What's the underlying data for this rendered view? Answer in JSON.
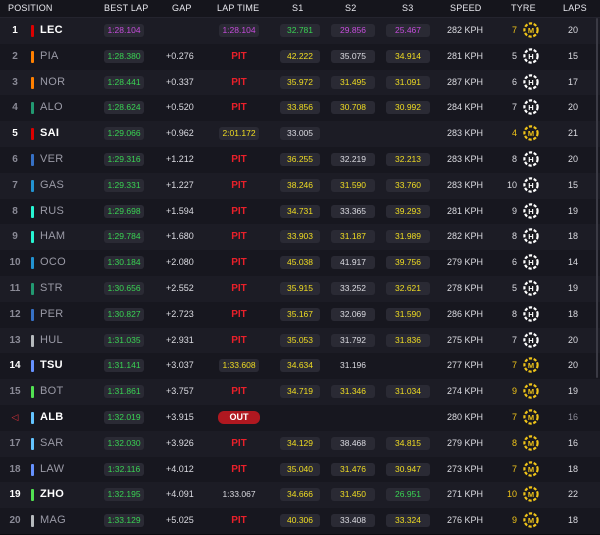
{
  "header": {
    "position": "POSITION",
    "best_lap": "BEST LAP",
    "gap": "GAP",
    "lap_time": "LAP TIME",
    "s1": "S1",
    "s2": "S2",
    "s3": "S3",
    "speed": "SPEED",
    "tyre": "TYRE",
    "laps": "LAPS"
  },
  "colors": {
    "green": "#39d353",
    "purple": "#c64cdc",
    "yellow": "#f0dd22",
    "pit_red": "#e8202a",
    "out_bg": "#b01820",
    "medium_tyre": "#f0c419",
    "hard_tyre": "#ffffff"
  },
  "rows": [
    {
      "pos": "1",
      "code": "LEC",
      "team_color": "#dc0000",
      "hi": true,
      "best": "1:28.104",
      "best_c": "purple",
      "gap": "",
      "lt": "1:28.104",
      "lt_c": "purple",
      "s1": "32.781",
      "s1_c": "green",
      "s2": "29.856",
      "s2_c": "purple",
      "s3": "25.467",
      "s3_c": "purple",
      "speed": "282 KPH",
      "tyre_laps": "7",
      "compound": "M",
      "laps": "20"
    },
    {
      "pos": "2",
      "code": "PIA",
      "team_color": "#ff8000",
      "hi": false,
      "best": "1:28.380",
      "best_c": "green",
      "gap": "+0.276",
      "lt": "PIT",
      "lt_c": "pit",
      "s1": "42.222",
      "s1_c": "yellow",
      "s2": "35.075",
      "s2_c": "white",
      "s3": "34.914",
      "s3_c": "yellow",
      "speed": "281 KPH",
      "tyre_laps": "5",
      "compound": "H",
      "laps": "15"
    },
    {
      "pos": "3",
      "code": "NOR",
      "team_color": "#ff8000",
      "hi": false,
      "best": "1:28.441",
      "best_c": "green",
      "gap": "+0.337",
      "lt": "PIT",
      "lt_c": "pit",
      "s1": "35.972",
      "s1_c": "yellow",
      "s2": "31.495",
      "s2_c": "yellow",
      "s3": "31.091",
      "s3_c": "yellow",
      "speed": "287 KPH",
      "tyre_laps": "6",
      "compound": "H",
      "laps": "17"
    },
    {
      "pos": "4",
      "code": "ALO",
      "team_color": "#229971",
      "hi": false,
      "best": "1:28.624",
      "best_c": "green",
      "gap": "+0.520",
      "lt": "PIT",
      "lt_c": "pit",
      "s1": "33.856",
      "s1_c": "yellow",
      "s2": "30.708",
      "s2_c": "yellow",
      "s3": "30.992",
      "s3_c": "yellow",
      "speed": "284 KPH",
      "tyre_laps": "7",
      "compound": "H",
      "laps": "20"
    },
    {
      "pos": "5",
      "code": "SAI",
      "team_color": "#dc0000",
      "hi": true,
      "best": "1:29.066",
      "best_c": "green",
      "gap": "+0.962",
      "lt": "2:01.172",
      "lt_c": "yellow",
      "s1": "33.005",
      "s1_c": "white",
      "s2": "",
      "s2_c": "none",
      "s3": "",
      "s3_c": "none",
      "speed": "283 KPH",
      "tyre_laps": "4",
      "compound": "M",
      "laps": "21"
    },
    {
      "pos": "6",
      "code": "VER",
      "team_color": "#3671c6",
      "hi": false,
      "best": "1:29.316",
      "best_c": "green",
      "gap": "+1.212",
      "lt": "PIT",
      "lt_c": "pit",
      "s1": "36.255",
      "s1_c": "yellow",
      "s2": "32.219",
      "s2_c": "white",
      "s3": "32.213",
      "s3_c": "yellow",
      "speed": "283 KPH",
      "tyre_laps": "8",
      "compound": "H",
      "laps": "20"
    },
    {
      "pos": "7",
      "code": "GAS",
      "team_color": "#2293d1",
      "hi": false,
      "best": "1:29.331",
      "best_c": "green",
      "gap": "+1.227",
      "lt": "PIT",
      "lt_c": "pit",
      "s1": "38.246",
      "s1_c": "yellow",
      "s2": "31.590",
      "s2_c": "yellow",
      "s3": "33.760",
      "s3_c": "yellow",
      "speed": "283 KPH",
      "tyre_laps": "10",
      "compound": "H",
      "laps": "15"
    },
    {
      "pos": "8",
      "code": "RUS",
      "team_color": "#27f4d2",
      "hi": false,
      "best": "1:29.698",
      "best_c": "green",
      "gap": "+1.594",
      "lt": "PIT",
      "lt_c": "pit",
      "s1": "34.731",
      "s1_c": "yellow",
      "s2": "33.365",
      "s2_c": "white",
      "s3": "39.293",
      "s3_c": "yellow",
      "speed": "281 KPH",
      "tyre_laps": "9",
      "compound": "H",
      "laps": "19"
    },
    {
      "pos": "9",
      "code": "HAM",
      "team_color": "#27f4d2",
      "hi": false,
      "best": "1:29.784",
      "best_c": "green",
      "gap": "+1.680",
      "lt": "PIT",
      "lt_c": "pit",
      "s1": "33.903",
      "s1_c": "yellow",
      "s2": "31.187",
      "s2_c": "yellow",
      "s3": "31.989",
      "s3_c": "yellow",
      "speed": "282 KPH",
      "tyre_laps": "8",
      "compound": "H",
      "laps": "18"
    },
    {
      "pos": "10",
      "code": "OCO",
      "team_color": "#2293d1",
      "hi": false,
      "best": "1:30.184",
      "best_c": "green",
      "gap": "+2.080",
      "lt": "PIT",
      "lt_c": "pit",
      "s1": "45.038",
      "s1_c": "yellow",
      "s2": "41.917",
      "s2_c": "white",
      "s3": "39.756",
      "s3_c": "yellow",
      "speed": "279 KPH",
      "tyre_laps": "6",
      "compound": "H",
      "laps": "14"
    },
    {
      "pos": "11",
      "code": "STR",
      "team_color": "#229971",
      "hi": false,
      "best": "1:30.656",
      "best_c": "green",
      "gap": "+2.552",
      "lt": "PIT",
      "lt_c": "pit",
      "s1": "35.915",
      "s1_c": "yellow",
      "s2": "33.252",
      "s2_c": "white",
      "s3": "32.621",
      "s3_c": "yellow",
      "speed": "278 KPH",
      "tyre_laps": "5",
      "compound": "H",
      "laps": "19"
    },
    {
      "pos": "12",
      "code": "PER",
      "team_color": "#3671c6",
      "hi": false,
      "best": "1:30.827",
      "best_c": "green",
      "gap": "+2.723",
      "lt": "PIT",
      "lt_c": "pit",
      "s1": "35.167",
      "s1_c": "yellow",
      "s2": "32.069",
      "s2_c": "white",
      "s3": "31.590",
      "s3_c": "yellow",
      "speed": "286 KPH",
      "tyre_laps": "8",
      "compound": "H",
      "laps": "18"
    },
    {
      "pos": "13",
      "code": "HUL",
      "team_color": "#b6babd",
      "hi": false,
      "best": "1:31.035",
      "best_c": "green",
      "gap": "+2.931",
      "lt": "PIT",
      "lt_c": "pit",
      "s1": "35.053",
      "s1_c": "yellow",
      "s2": "31.792",
      "s2_c": "white",
      "s3": "31.836",
      "s3_c": "yellow",
      "speed": "275 KPH",
      "tyre_laps": "7",
      "compound": "H",
      "laps": "20"
    },
    {
      "pos": "14",
      "code": "TSU",
      "team_color": "#6692ff",
      "hi": true,
      "best": "1:31.141",
      "best_c": "green",
      "gap": "+3.037",
      "lt": "1:33.608",
      "lt_c": "yellow",
      "s1": "34.634",
      "s1_c": "yellow",
      "s2": "31.196",
      "s2_c": "plain",
      "s3": "",
      "s3_c": "none",
      "speed": "277 KPH",
      "tyre_laps": "7",
      "compound": "M",
      "laps": "20"
    },
    {
      "pos": "15",
      "code": "BOT",
      "team_color": "#52e252",
      "hi": false,
      "best": "1:31.861",
      "best_c": "green",
      "gap": "+3.757",
      "lt": "PIT",
      "lt_c": "pit",
      "s1": "34.719",
      "s1_c": "yellow",
      "s2": "31.346",
      "s2_c": "yellow",
      "s3": "31.034",
      "s3_c": "yellow",
      "speed": "274 KPH",
      "tyre_laps": "9",
      "compound": "M",
      "laps": "19"
    },
    {
      "pos": "◁",
      "code": "ALB",
      "team_color": "#64c4ff",
      "hi": true,
      "flag": true,
      "best": "1:32.019",
      "best_c": "green",
      "gap": "+3.915",
      "lt": "OUT",
      "lt_c": "out",
      "s1": "",
      "s1_c": "none",
      "s2": "",
      "s2_c": "none",
      "s3": "",
      "s3_c": "none",
      "speed": "280 KPH",
      "tyre_laps": "7",
      "compound": "M",
      "laps": "16",
      "laps_dim": true
    },
    {
      "pos": "17",
      "code": "SAR",
      "team_color": "#64c4ff",
      "hi": false,
      "best": "1:32.030",
      "best_c": "green",
      "gap": "+3.926",
      "lt": "PIT",
      "lt_c": "pit",
      "s1": "34.129",
      "s1_c": "yellow",
      "s2": "38.468",
      "s2_c": "white",
      "s3": "34.815",
      "s3_c": "yellow",
      "speed": "279 KPH",
      "tyre_laps": "8",
      "compound": "M",
      "laps": "16"
    },
    {
      "pos": "18",
      "code": "LAW",
      "team_color": "#6692ff",
      "hi": false,
      "best": "1:32.116",
      "best_c": "green",
      "gap": "+4.012",
      "lt": "PIT",
      "lt_c": "pit",
      "s1": "35.040",
      "s1_c": "yellow",
      "s2": "31.476",
      "s2_c": "yellow",
      "s3": "30.947",
      "s3_c": "yellow",
      "speed": "273 KPH",
      "tyre_laps": "7",
      "compound": "M",
      "laps": "18"
    },
    {
      "pos": "19",
      "code": "ZHO",
      "team_color": "#52e252",
      "hi": true,
      "best": "1:32.195",
      "best_c": "green",
      "gap": "+4.091",
      "lt": "1:33.067",
      "lt_c": "plain",
      "s1": "34.666",
      "s1_c": "yellow",
      "s2": "31.450",
      "s2_c": "yellow",
      "s3": "26.951",
      "s3_c": "green",
      "speed": "271 KPH",
      "tyre_laps": "10",
      "compound": "M",
      "laps": "22"
    },
    {
      "pos": "20",
      "code": "MAG",
      "team_color": "#b6babd",
      "hi": false,
      "best": "1:33.129",
      "best_c": "green",
      "gap": "+5.025",
      "lt": "PIT",
      "lt_c": "pit",
      "s1": "40.306",
      "s1_c": "yellow",
      "s2": "33.408",
      "s2_c": "white",
      "s3": "33.324",
      "s3_c": "yellow",
      "speed": "276 KPH",
      "tyre_laps": "9",
      "compound": "M",
      "laps": "18"
    }
  ]
}
